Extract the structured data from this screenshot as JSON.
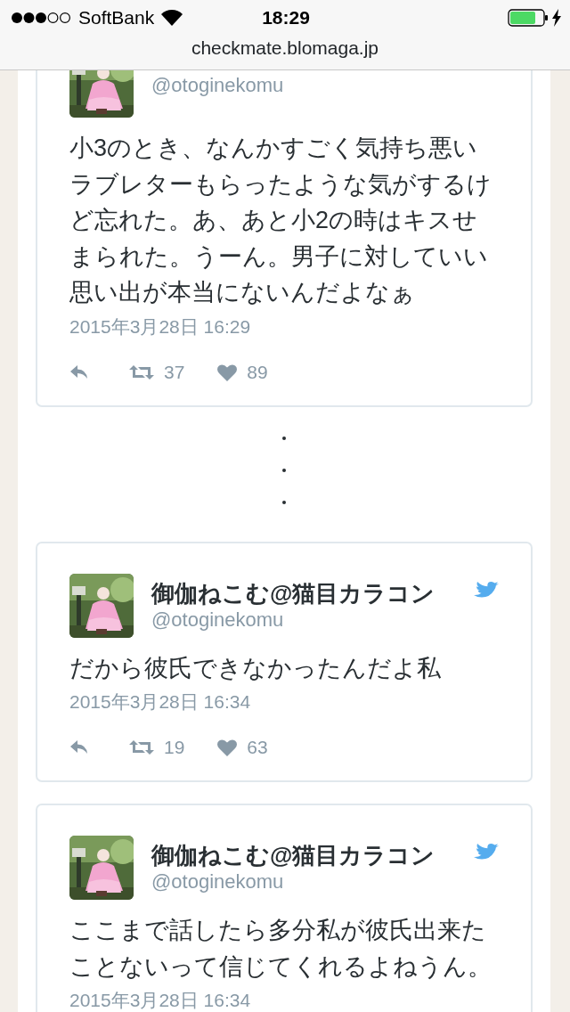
{
  "status_bar": {
    "carrier": "SoftBank",
    "time": "18:29"
  },
  "address_bar": {
    "url": "checkmate.blomaga.jp"
  },
  "tweets": [
    {
      "handle": "@otoginekomu",
      "text": "小3のとき、なんかすごく気持ち悪いラブレターもらったような気がするけど忘れた。あ、あと小2の時はキスせまられた。うーん。男子に対していい思い出が本当にないんだよなぁ",
      "date": "2015年3月28日 16:29",
      "retweets": "37",
      "likes": "89"
    },
    {
      "name": "御伽ねこむ@猫目カラコン",
      "handle": "@otoginekomu",
      "text": "だから彼氏できなかったんだよ私",
      "date": "2015年3月28日 16:34",
      "retweets": "19",
      "likes": "63"
    },
    {
      "name": "御伽ねこむ@猫目カラコン",
      "handle": "@otoginekomu",
      "text": "ここまで話したら多分私が彼氏出来たことないって信じてくれるよねうん。",
      "date": "2015年3月28日 16:34"
    }
  ]
}
